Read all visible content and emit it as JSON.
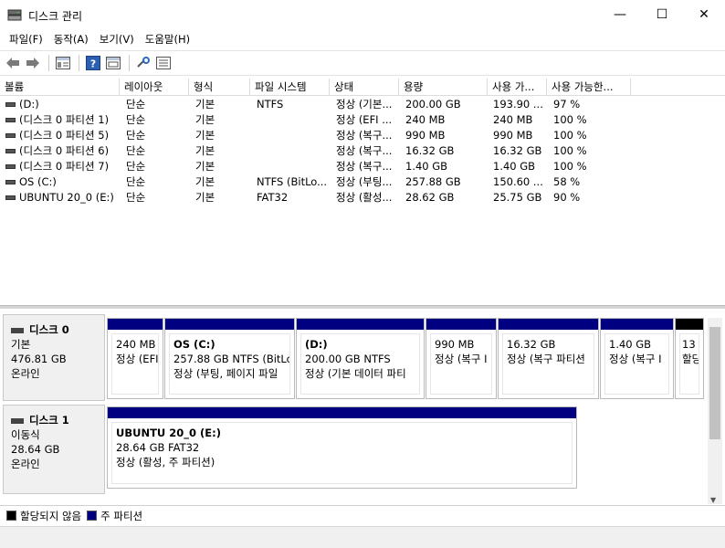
{
  "window": {
    "title": "디스크 관리",
    "min": "—",
    "max": "☐",
    "close": "✕"
  },
  "menu": [
    "파일(F)",
    "동작(A)",
    "보기(V)",
    "도움말(H)"
  ],
  "columns": [
    "볼륨",
    "레이아웃",
    "형식",
    "파일 시스템",
    "상태",
    "용량",
    "사용 가...",
    "사용 가능한..."
  ],
  "volumes": [
    {
      "name": "(D:)",
      "layout": "단순",
      "type": "기본",
      "fs": "NTFS",
      "status": "정상 (기본...",
      "capacity": "200.00 GB",
      "free": "193.90 ...",
      "pct": "97 %"
    },
    {
      "name": "(디스크 0 파티션 1)",
      "layout": "단순",
      "type": "기본",
      "fs": "",
      "status": "정상 (EFI ...",
      "capacity": "240 MB",
      "free": "240 MB",
      "pct": "100 %"
    },
    {
      "name": "(디스크 0 파티션 5)",
      "layout": "단순",
      "type": "기본",
      "fs": "",
      "status": "정상 (복구...",
      "capacity": "990 MB",
      "free": "990 MB",
      "pct": "100 %"
    },
    {
      "name": "(디스크 0 파티션 6)",
      "layout": "단순",
      "type": "기본",
      "fs": "",
      "status": "정상 (복구...",
      "capacity": "16.32 GB",
      "free": "16.32 GB",
      "pct": "100 %"
    },
    {
      "name": "(디스크 0 파티션 7)",
      "layout": "단순",
      "type": "기본",
      "fs": "",
      "status": "정상 (복구...",
      "capacity": "1.40 GB",
      "free": "1.40 GB",
      "pct": "100 %"
    },
    {
      "name": "OS (C:)",
      "layout": "단순",
      "type": "기본",
      "fs": "NTFS (BitLo...",
      "status": "정상 (부팅...",
      "capacity": "257.88 GB",
      "free": "150.60 ...",
      "pct": "58 %"
    },
    {
      "name": "UBUNTU 20_0 (E:)",
      "layout": "단순",
      "type": "기본",
      "fs": "FAT32",
      "status": "정상 (활성...",
      "capacity": "28.62 GB",
      "free": "25.75 GB",
      "pct": "90 %"
    }
  ],
  "disks": [
    {
      "name": "디스크 0",
      "kind": "기본",
      "size": "476.81 GB",
      "state": "온라인",
      "partitions": [
        {
          "name": "",
          "line1": "240 MB",
          "line2": "정상 (EFI"
        },
        {
          "name": "OS  (C:)",
          "line1": "257.88 GB NTFS (BitLoc",
          "line2": "정상 (부팅, 페이지 파일"
        },
        {
          "name": "(D:)",
          "line1": "200.00 GB NTFS",
          "line2": "정상 (기본 데이터 파티"
        },
        {
          "name": "",
          "line1": "990 MB",
          "line2": "정상 (복구 I"
        },
        {
          "name": "",
          "line1": "16.32 GB",
          "line2": "정상 (복구 파티션"
        },
        {
          "name": "",
          "line1": "1.40 GB",
          "line2": "정상 (복구 I"
        },
        {
          "name": "",
          "line1": "13",
          "line2": "할당"
        }
      ]
    },
    {
      "name": "디스크 1",
      "kind": "이동식",
      "size": "28.64 GB",
      "state": "온라인",
      "partitions": [
        {
          "name": "UBUNTU 20_0  (E:)",
          "line1": "28.64 GB FAT32",
          "line2": "정상 (활성, 주 파티션)"
        }
      ]
    }
  ],
  "legend": [
    {
      "label": "할당되지 않음",
      "color": "#000000"
    },
    {
      "label": "주 파티션",
      "color": "#000080"
    }
  ],
  "colors": {
    "primary_partition": "#000080",
    "unallocated": "#000000"
  }
}
